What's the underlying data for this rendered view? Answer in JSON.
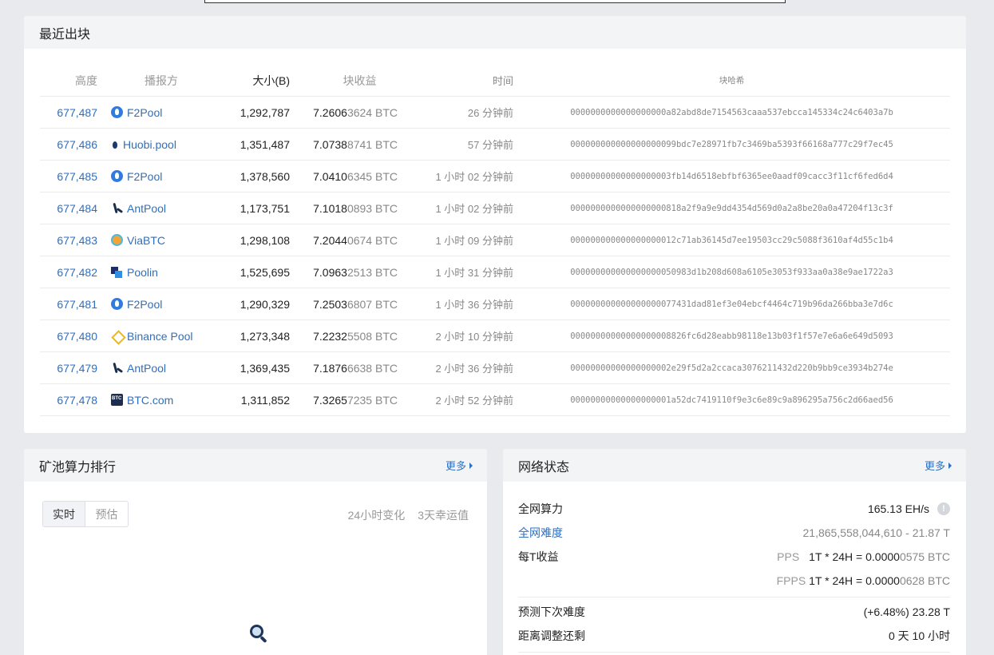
{
  "recent_blocks": {
    "title": "最近出块",
    "headers": {
      "height": "高度",
      "pool": "播报方",
      "size": "大小(B)",
      "reward": "块收益",
      "time": "时间",
      "hash": "块哈希"
    },
    "rows": [
      {
        "height": "677,487",
        "pool": "F2Pool",
        "icon": "f2pool-icon",
        "size": "1,292,787",
        "reward_main": "7.2606",
        "reward_tail": "3624 BTC",
        "time": "26 分钟前",
        "hash": "0000000000000000000a82abd8de7154563caaa537ebcca145334c24c6403a7b"
      },
      {
        "height": "677,486",
        "pool": "Huobi.pool",
        "icon": "huobi-icon",
        "size": "1,351,487",
        "reward_main": "7.0738",
        "reward_tail": "8741 BTC",
        "time": "57 分钟前",
        "hash": "000000000000000000099bdc7e28971fb7c3469ba5393f66168a777c29f7ec45"
      },
      {
        "height": "677,485",
        "pool": "F2Pool",
        "icon": "f2pool-icon",
        "size": "1,378,560",
        "reward_main": "7.0410",
        "reward_tail": "6345 BTC",
        "time": "1 小时 02 分钟前",
        "hash": "00000000000000000003fb14d6518ebfbf6365ee0aadf09cacc3f11cf6fed6d4"
      },
      {
        "height": "677,484",
        "pool": "AntPool",
        "icon": "antpool-icon",
        "size": "1,173,751",
        "reward_main": "7.1018",
        "reward_tail": "0893 BTC",
        "time": "1 小时 02 分钟前",
        "hash": "0000000000000000000818a2f9a9e9dd4354d569d0a2a8be20a0a47204f13c3f"
      },
      {
        "height": "677,483",
        "pool": "ViaBTC",
        "icon": "viabtc-icon",
        "size": "1,298,108",
        "reward_main": "7.2044",
        "reward_tail": "0674 BTC",
        "time": "1 小时 09 分钟前",
        "hash": "000000000000000000012c71ab36145d7ee19503cc29c5088f3610af4d55c1b4"
      },
      {
        "height": "677,482",
        "pool": "Poolin",
        "icon": "poolin-icon",
        "size": "1,525,695",
        "reward_main": "7.0963",
        "reward_tail": "2513 BTC",
        "time": "1 小时 31 分钟前",
        "hash": "000000000000000000050983d1b208d608a6105e3053f933aa0a38e9ae1722a3"
      },
      {
        "height": "677,481",
        "pool": "F2Pool",
        "icon": "f2pool-icon",
        "size": "1,290,329",
        "reward_main": "7.2503",
        "reward_tail": "6807 BTC",
        "time": "1 小时 36 分钟前",
        "hash": "000000000000000000077431dad81ef3e04ebcf4464c719b96da266bba3e7d6c"
      },
      {
        "height": "677,480",
        "pool": "Binance Pool",
        "icon": "binance-pool-icon",
        "size": "1,273,348",
        "reward_main": "7.2232",
        "reward_tail": "5508 BTC",
        "time": "2 小时 10 分钟前",
        "hash": "00000000000000000008826fc6d28eabb98118e13b03f1f57e7e6a6e649d5093"
      },
      {
        "height": "677,479",
        "pool": "AntPool",
        "icon": "antpool-icon",
        "size": "1,369,435",
        "reward_main": "7.1876",
        "reward_tail": "6638 BTC",
        "time": "2 小时 36 分钟前",
        "hash": "00000000000000000002e29f5d2a2ccaca3076211432d220b9bb9ce3934b274e"
      },
      {
        "height": "677,478",
        "pool": "BTC.com",
        "icon": "btccom-icon",
        "size": "1,311,852",
        "reward_main": "7.3265",
        "reward_tail": "7235 BTC",
        "time": "2 小时 52 分钟前",
        "hash": "00000000000000000001a52dc7419110f9e3c6e89c9a896295a756c2d66aed56"
      }
    ]
  },
  "pool_rank": {
    "title": "矿池算力排行",
    "more": "更多",
    "tabs": [
      "实时",
      "预估"
    ],
    "links": [
      "24小时变化",
      "3天幸运值"
    ],
    "empty_icon": "search-icon"
  },
  "network": {
    "title": "网络状态",
    "more": "更多",
    "hashrate_label": "全网算力",
    "hashrate_value": "165.13 EH/s",
    "difficulty_label": "全网难度",
    "difficulty_value": "21,865,558,044,610",
    "difficulty_short": "21.87 T",
    "income_label": "每T收益",
    "pps_prefix": "PPS",
    "pps_main": "1T * 24H = 0.0000",
    "pps_tail": "0575 BTC",
    "fpps_prefix": "FPPS",
    "fpps_main": "1T * 24H = 0.0000",
    "fpps_tail": "0628 BTC",
    "next_diff_label": "预测下次难度",
    "next_diff_change": "(+6.48%)",
    "next_diff_value": "23.28 T",
    "adjust_label": "距离调整还剩",
    "adjust_value": "0 天 10 小时"
  },
  "colors": {
    "link": "#2f6fbf",
    "background": "#e8eaee",
    "card_header": "#f3f4f6"
  }
}
